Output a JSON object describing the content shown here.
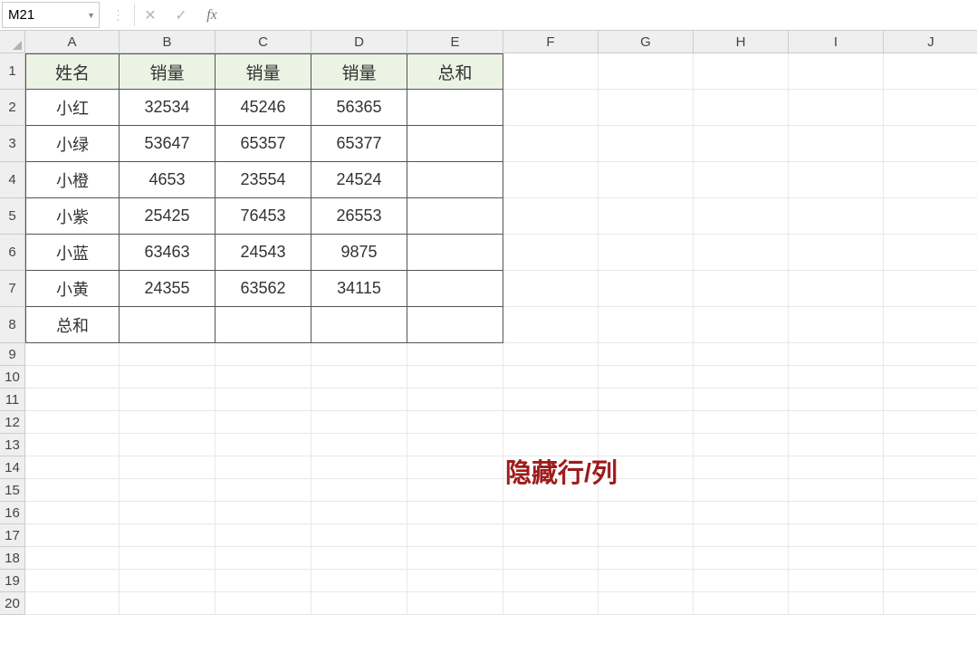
{
  "name_box": "M21",
  "formula_value": "",
  "columns": [
    "A",
    "B",
    "C",
    "D",
    "E",
    "F",
    "G",
    "H",
    "I",
    "J"
  ],
  "row_count": 20,
  "headers": {
    "A": "姓名",
    "B": "销量",
    "C": "销量",
    "D": "销量",
    "E": "总和"
  },
  "data_rows": [
    {
      "A": "小红",
      "B": "32534",
      "C": "45246",
      "D": "56365",
      "E": ""
    },
    {
      "A": "小绿",
      "B": "53647",
      "C": "65357",
      "D": "65377",
      "E": ""
    },
    {
      "A": "小橙",
      "B": "4653",
      "C": "23554",
      "D": "24524",
      "E": ""
    },
    {
      "A": "小紫",
      "B": "25425",
      "C": "76453",
      "D": "26553",
      "E": ""
    },
    {
      "A": "小蓝",
      "B": "63463",
      "C": "24543",
      "D": "9875",
      "E": ""
    },
    {
      "A": "小黄",
      "B": "24355",
      "C": "63562",
      "D": "34115",
      "E": ""
    },
    {
      "A": "总和",
      "B": "",
      "C": "",
      "D": "",
      "E": ""
    }
  ],
  "annotation": "隐藏行/列",
  "colors": {
    "header_fill": "#ecf3e4",
    "annotation": "#a01b1b"
  }
}
